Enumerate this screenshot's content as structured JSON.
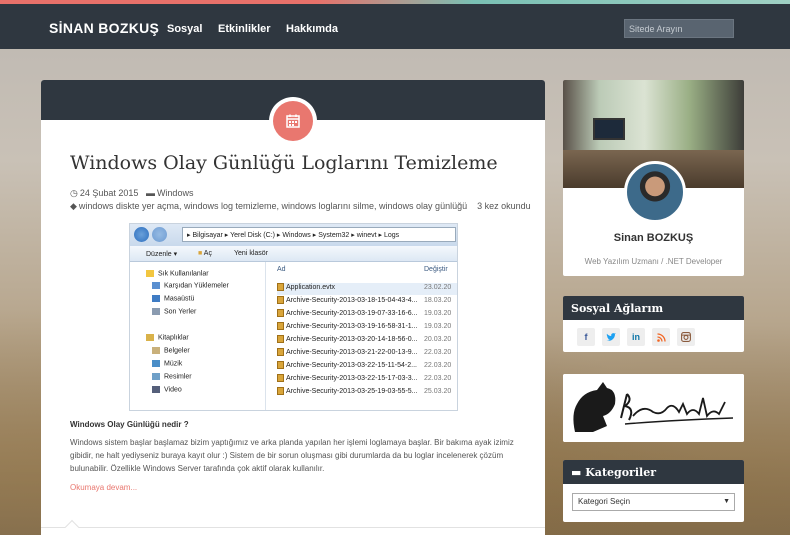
{
  "nav": {
    "brand": "SİNAN BOZKUŞ",
    "items": [
      {
        "label": "Sosyal"
      },
      {
        "label": "Etkinlikler"
      },
      {
        "label": "Hakkımda"
      }
    ],
    "search_placeholder": "Sitede Arayın"
  },
  "post": {
    "title": "Windows Olay Günlüğü Loglarını Temizleme",
    "date": "24 Şubat 2015",
    "category": "Windows",
    "tags": "windows diskte yer açma, windows log temizleme, windows loglarını silme, windows olay günlüğü",
    "read_count": "3 kez okundu",
    "subheading": "Windows Olay Günlüğü nedir ?",
    "paragraph1": "Windows sistem başlar başlamaz bizim yaptığımız ve arka planda yapılan her işlemi loglamaya başlar. Bir bakıma ayak izimiz gibidir, ne halt yediyseniz buraya kayıt olur :) Sistem de bir sorun oluşması gibi durumlarda da bu loglar incelenerek çözüm bulunabilir. Özellikle Windows Server tarafında çok aktif olarak kullanılır.",
    "read_more": "Okumaya devam...",
    "screenshot": {
      "path": [
        "Bilgisayar",
        "Yerel Disk (C:)",
        "Windows",
        "System32",
        "winevt",
        "Logs"
      ],
      "commands": [
        "Düzenle ▾",
        "Aç",
        "Yeni klasör"
      ],
      "tree": [
        {
          "label": "Sık Kullanılanlar"
        },
        {
          "label": "Karşıdan Yüklemeler"
        },
        {
          "label": "Masaüstü"
        },
        {
          "label": "Son Yerler"
        },
        {
          "label": "Kitaplıklar"
        },
        {
          "label": "Belgeler"
        },
        {
          "label": "Müzik"
        },
        {
          "label": "Resimler"
        },
        {
          "label": "Video"
        }
      ],
      "columns": [
        "Ad",
        "Değiştir"
      ],
      "files": [
        {
          "name": "Application.evtx",
          "date": "23.02.20"
        },
        {
          "name": "Archive-Security-2013-03-18-15-04-43-4...",
          "date": "18.03.20"
        },
        {
          "name": "Archive-Security-2013-03-19-07-33-16-6...",
          "date": "19.03.20"
        },
        {
          "name": "Archive-Security-2013-03-19-16-58-31-1...",
          "date": "19.03.20"
        },
        {
          "name": "Archive-Security-2013-03-20-14-18-56-0...",
          "date": "20.03.20"
        },
        {
          "name": "Archive-Security-2013-03-21-22-00-13-9...",
          "date": "22.03.20"
        },
        {
          "name": "Archive-Security-2013-03-22-15-11-54-2...",
          "date": "22.03.20"
        },
        {
          "name": "Archive-Security-2013-03-22-15-17-03-3...",
          "date": "22.03.20"
        },
        {
          "name": "Archive-Security-2013-03-25-19-03-55-5...",
          "date": "25.03.20"
        }
      ]
    }
  },
  "sidebar": {
    "profile": {
      "name": "Sinan BOZKUŞ",
      "role": "Web Yazılım Uzmanı / .NET Developer"
    },
    "social": {
      "title": "Sosyal Ağlarım",
      "icons": [
        "f",
        "t",
        "in",
        "rss",
        "ig"
      ]
    },
    "signature": {
      "alt": "K. Atatürk"
    },
    "categories": {
      "title": "Kategoriler",
      "select_value": "Kategori Seçin"
    }
  },
  "colors": {
    "accent": "#e9776f",
    "nav": "#2f3740"
  }
}
